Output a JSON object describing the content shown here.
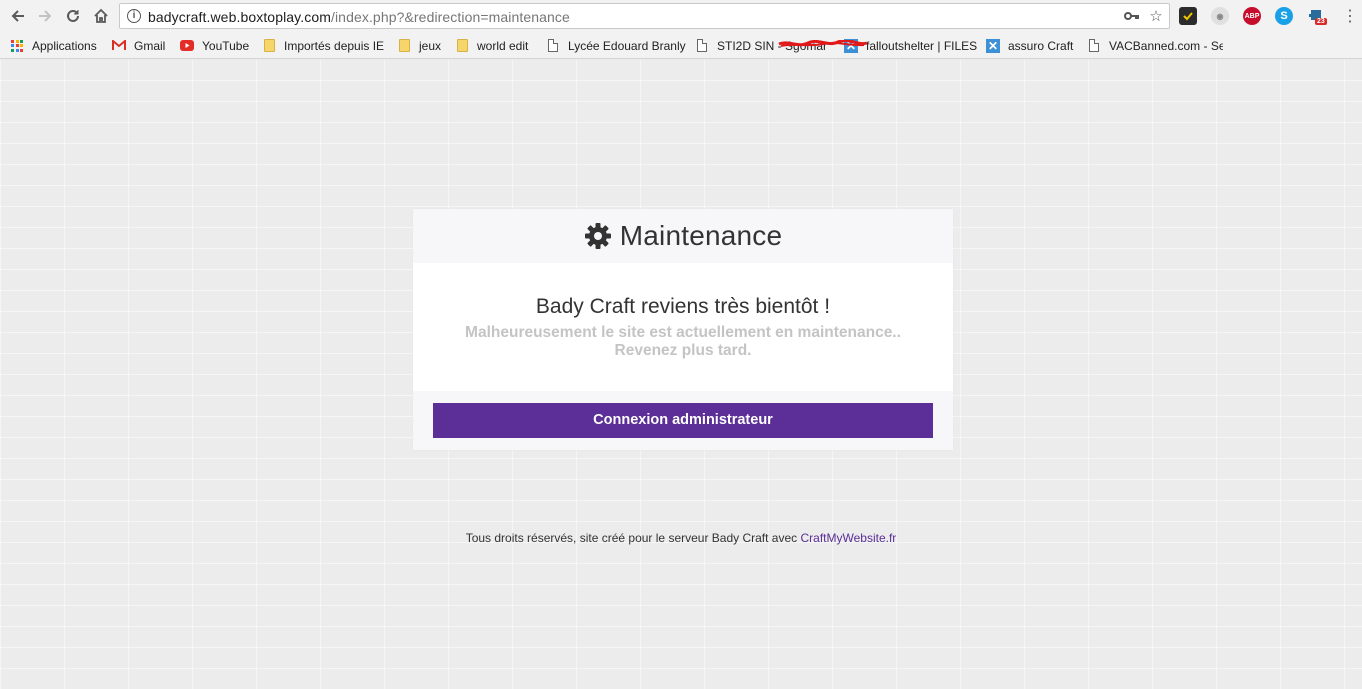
{
  "browser": {
    "url_host": "badycraft.web.boxtoplay.com",
    "url_rest": "/index.php?&redirection=maintenance",
    "extensions": [
      {
        "name": "norton-safe-web",
        "color": "#2b2b2b"
      },
      {
        "name": "privacy-badger",
        "color": "#aaaaaa"
      },
      {
        "name": "adblock-plus",
        "label": "ABP",
        "color": "#c70d2c"
      },
      {
        "name": "skype",
        "color": "#19a0e6"
      },
      {
        "name": "extension-notifications",
        "badge": "23",
        "color": "#276c9a"
      }
    ]
  },
  "bookmarks": [
    {
      "label": "Applications",
      "icon": "apps-grid-icon"
    },
    {
      "label": "Gmail",
      "icon": "gmail-icon"
    },
    {
      "label": "YouTube",
      "icon": "youtube-icon"
    },
    {
      "label": "Importés depuis IE",
      "icon": "folder-icon"
    },
    {
      "label": "jeux",
      "icon": "folder-icon"
    },
    {
      "label": "world edit",
      "icon": "folder-icon"
    },
    {
      "label": "Lycée Edouard Branly",
      "icon": "page-icon"
    },
    {
      "label": "STI2D SIN - Sgomar",
      "icon": "page-icon"
    },
    {
      "label": "falloutshelter | FILES",
      "icon": "x-icon"
    },
    {
      "label": "assuro Craft",
      "icon": "x-icon"
    },
    {
      "label": "VACBanned.com - Se",
      "icon": "page-icon"
    }
  ],
  "maintenance": {
    "title": "Maintenance",
    "heading": "Bady Craft reviens très bientôt !",
    "message_line1": "Malheureusement le site est actuellement en maintenance..",
    "message_line2": "Revenez plus tard.",
    "button_label": "Connexion administrateur"
  },
  "footer": {
    "text": "Tous droits réservés, site créé pour le serveur Bady Craft avec ",
    "link_label": "CraftMyWebsite.fr"
  },
  "colors": {
    "accent": "#5b2f97",
    "page_background": "#ececec"
  }
}
